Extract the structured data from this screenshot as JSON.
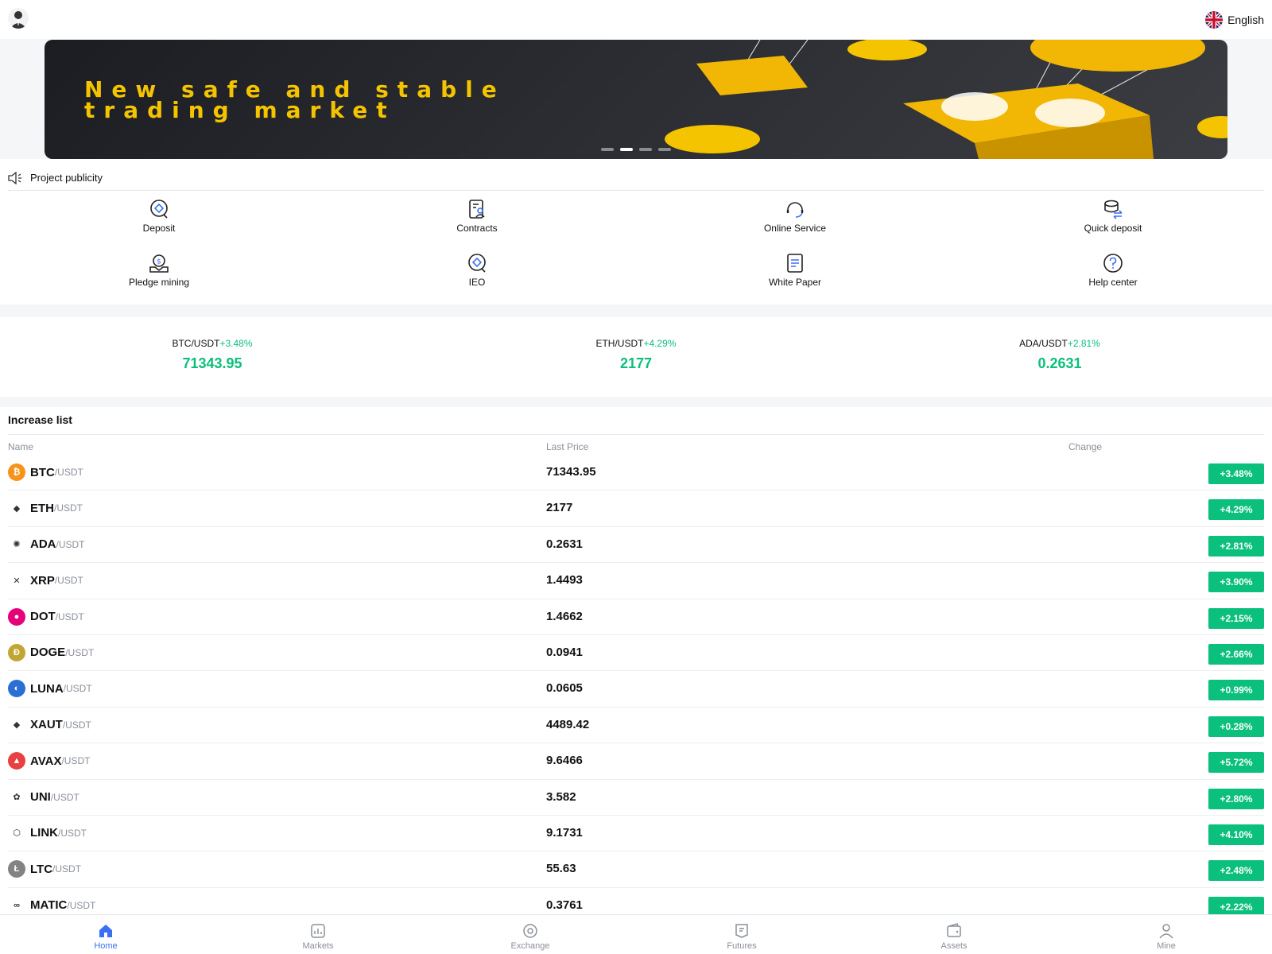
{
  "header": {
    "language": "English"
  },
  "banner": {
    "headline_line1": "New safe and stable",
    "headline_line2": "trading market",
    "dots": 4,
    "active_dot": 1
  },
  "notice": {
    "label": "Project publicity"
  },
  "quick_actions": [
    {
      "label": "Deposit",
      "icon": "deposit-icon"
    },
    {
      "label": "Contracts",
      "icon": "contracts-icon"
    },
    {
      "label": "Online Service",
      "icon": "headset-icon"
    },
    {
      "label": "Quick deposit",
      "icon": "coins-exchange-icon"
    },
    {
      "label": "Pledge mining",
      "icon": "pledge-icon"
    },
    {
      "label": "IEO",
      "icon": "ieo-icon"
    },
    {
      "label": "White Paper",
      "icon": "document-icon"
    },
    {
      "label": "Help center",
      "icon": "help-icon"
    }
  ],
  "tickers": [
    {
      "pair": "BTC/USDT",
      "change": "+3.48%",
      "price": "71343.95"
    },
    {
      "pair": "ETH/USDT",
      "change": "+4.29%",
      "price": "2177"
    },
    {
      "pair": "ADA/USDT",
      "change": "+2.81%",
      "price": "0.2631"
    }
  ],
  "increase_list": {
    "title": "Increase list",
    "columns": {
      "name": "Name",
      "last_price": "Last Price",
      "change": "Change"
    },
    "rows": [
      {
        "symbol": "BTC",
        "quote": "/USDT",
        "price": "71343.95",
        "change": "+3.48%",
        "color": "#f7931a",
        "glyph": "₿"
      },
      {
        "symbol": "ETH",
        "quote": "/USDT",
        "price": "2177",
        "change": "+4.29%",
        "color": "#ffffff",
        "glyph": "◆"
      },
      {
        "symbol": "ADA",
        "quote": "/USDT",
        "price": "0.2631",
        "change": "+2.81%",
        "color": "#ffffff",
        "glyph": "✺"
      },
      {
        "symbol": "XRP",
        "quote": "/USDT",
        "price": "1.4493",
        "change": "+3.90%",
        "color": "#ffffff",
        "glyph": "✕"
      },
      {
        "symbol": "DOT",
        "quote": "/USDT",
        "price": "1.4662",
        "change": "+2.15%",
        "color": "#e6007a",
        "glyph": "●"
      },
      {
        "symbol": "DOGE",
        "quote": "/USDT",
        "price": "0.0941",
        "change": "+2.66%",
        "color": "#c2a633",
        "glyph": "Ð"
      },
      {
        "symbol": "LUNA",
        "quote": "/USDT",
        "price": "0.0605",
        "change": "+0.99%",
        "color": "#2b6ed6",
        "glyph": "◐"
      },
      {
        "symbol": "XAUT",
        "quote": "/USDT",
        "price": "4489.42",
        "change": "+0.28%",
        "color": "#ffffff",
        "glyph": "◆"
      },
      {
        "symbol": "AVAX",
        "quote": "/USDT",
        "price": "9.6466",
        "change": "+5.72%",
        "color": "#e84142",
        "glyph": "▲"
      },
      {
        "symbol": "UNI",
        "quote": "/USDT",
        "price": "3.582",
        "change": "+2.80%",
        "color": "#ffffff",
        "glyph": "✿"
      },
      {
        "symbol": "LINK",
        "quote": "/USDT",
        "price": "9.1731",
        "change": "+4.10%",
        "color": "#ffffff",
        "glyph": "⬡"
      },
      {
        "symbol": "LTC",
        "quote": "/USDT",
        "price": "55.63",
        "change": "+2.48%",
        "color": "#838383",
        "glyph": "Ł"
      },
      {
        "symbol": "MATIC",
        "quote": "/USDT",
        "price": "0.3761",
        "change": "+2.22%",
        "color": "#ffffff",
        "glyph": "∞"
      }
    ]
  },
  "tabbar": [
    {
      "label": "Home",
      "icon": "home-icon",
      "active": true
    },
    {
      "label": "Markets",
      "icon": "markets-icon",
      "active": false
    },
    {
      "label": "Exchange",
      "icon": "exchange-icon",
      "active": false
    },
    {
      "label": "Futures",
      "icon": "futures-icon",
      "active": false
    },
    {
      "label": "Assets",
      "icon": "wallet-icon",
      "active": false
    },
    {
      "label": "Mine",
      "icon": "user-icon",
      "active": false
    }
  ],
  "colors": {
    "positive": "#0bbf7c",
    "accent": "#3b6ff5",
    "banner_text": "#f5c400"
  }
}
